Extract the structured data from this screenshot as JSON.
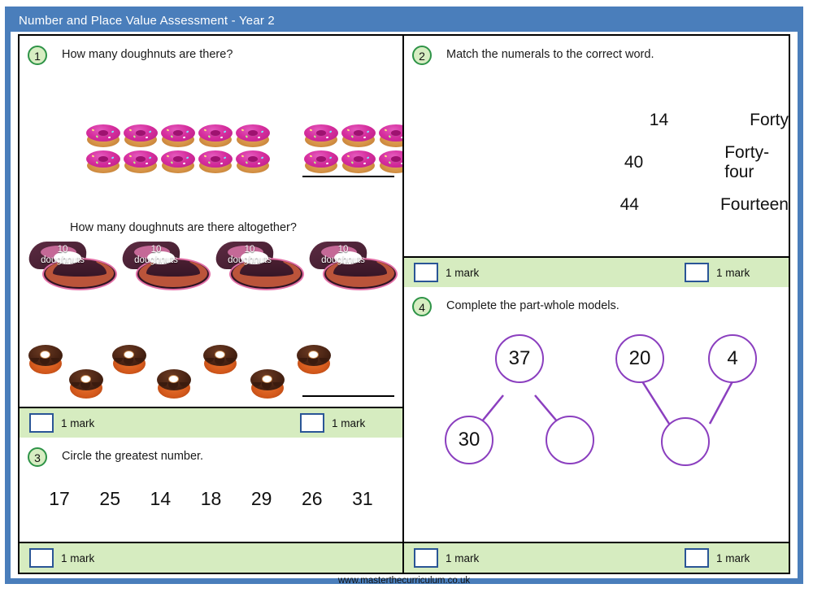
{
  "window": {
    "title": "Number and Place Value Assessment - Year 2",
    "title_bar_color": "#4a7ebb",
    "frame_color": "#4a7ebb"
  },
  "footer": {
    "url": "www.masterthecurriculum.co.uk"
  },
  "theme": {
    "marks_bar_color": "#d6ecc0",
    "question_circle_fill": "#d7edc2",
    "question_circle_border": "#2e9347",
    "mark_box_border": "#2a5596",
    "part_whole_color": "#8b3fbf"
  },
  "questions": {
    "q1": {
      "number": "1",
      "prompt": "How many doughnuts are there?",
      "prompt_b": "How many doughnuts are there altogether?",
      "doughnuts": {
        "rows": 2,
        "group_a_per_row": 5,
        "group_b_per_row": 3,
        "total": 16,
        "type": "pink-iced-doughnut"
      },
      "boxes": {
        "count": 4,
        "label_number": "10",
        "label_word": "doughnuts",
        "loose_doughnuts": 7,
        "total": 47
      },
      "marks": [
        {
          "label": "1 mark"
        },
        {
          "label": "1 mark"
        }
      ]
    },
    "q2": {
      "number": "2",
      "prompt": "Match the numerals to the correct word.",
      "numerals": [
        "14",
        "40",
        "44"
      ],
      "words": [
        "Forty",
        "Forty-four",
        "Fourteen"
      ],
      "marks": [
        {
          "label": "1 mark"
        },
        {
          "label": "1 mark"
        }
      ]
    },
    "q3": {
      "number": "3",
      "prompt": "Circle the greatest number.",
      "numbers": [
        "17",
        "25",
        "14",
        "18",
        "29",
        "26",
        "31"
      ],
      "marks": [
        {
          "label": "1 mark"
        }
      ]
    },
    "q4": {
      "number": "4",
      "prompt": "Complete the part-whole models.",
      "models": [
        {
          "orientation": "whole-top",
          "whole": "37",
          "part_left": "30",
          "part_right": ""
        },
        {
          "orientation": "whole-bottom",
          "whole": "",
          "part_left": "20",
          "part_right": "4"
        }
      ],
      "marks": [
        {
          "label": "1 mark"
        },
        {
          "label": "1 mark"
        }
      ]
    }
  }
}
